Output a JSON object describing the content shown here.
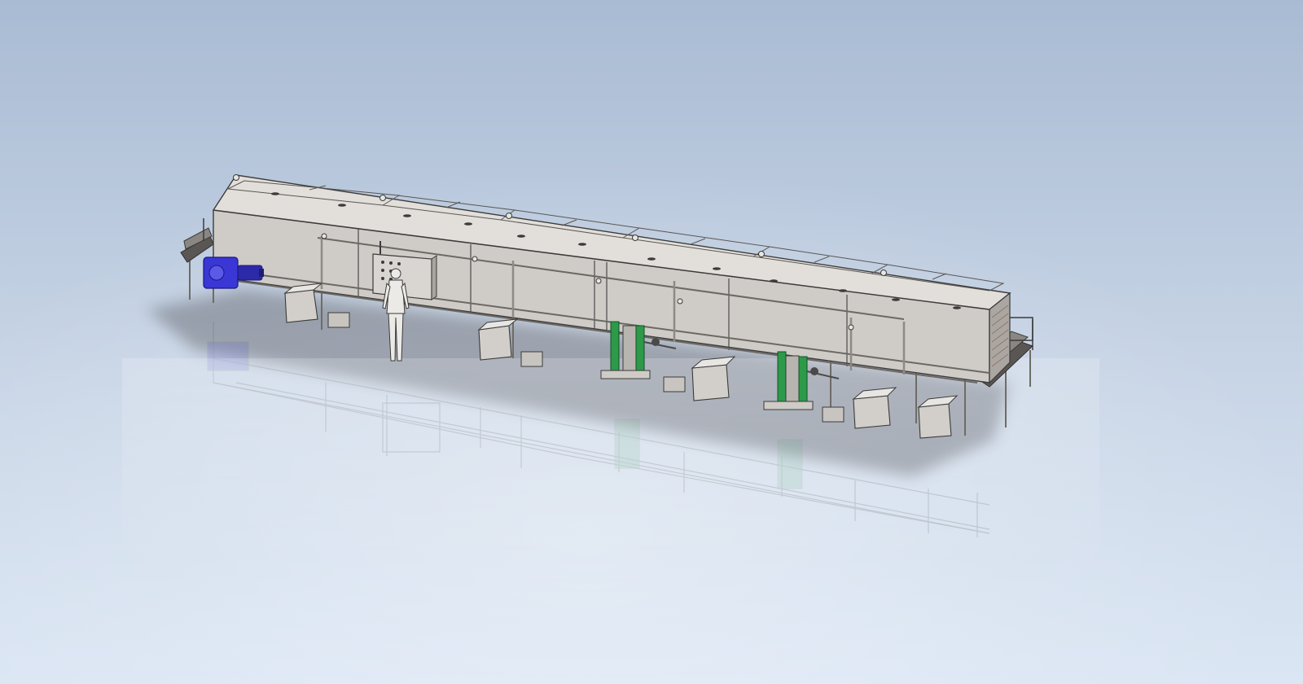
{
  "viewport": {
    "background": {
      "top": "#a9bbd3",
      "middle": "#c8d5e6",
      "bottom": "#dbe6f4"
    },
    "floor_reflection": true
  },
  "model": {
    "housing_color": "#cfcbc6",
    "housing_top_color": "#e2dfdb",
    "housing_dark_color": "#aaa6a1",
    "edge_color": "#3b3b3b",
    "frame_color": "#8e8a86",
    "shadow_color": "#5e6168",
    "components": [
      {
        "name": "housing-section",
        "count": 6
      },
      {
        "name": "lid-panel",
        "count": 12
      },
      {
        "name": "drive-gear-motor",
        "color": "#3a37d6"
      },
      {
        "name": "heat-exchanger",
        "count": 2,
        "color": "#2c9a48"
      },
      {
        "name": "control-cabinet",
        "count": 1
      },
      {
        "name": "pump-tank",
        "count": 5
      },
      {
        "name": "infeed-conveyor"
      },
      {
        "name": "outfeed-conveyor"
      },
      {
        "name": "human-scale-figure"
      }
    ]
  }
}
